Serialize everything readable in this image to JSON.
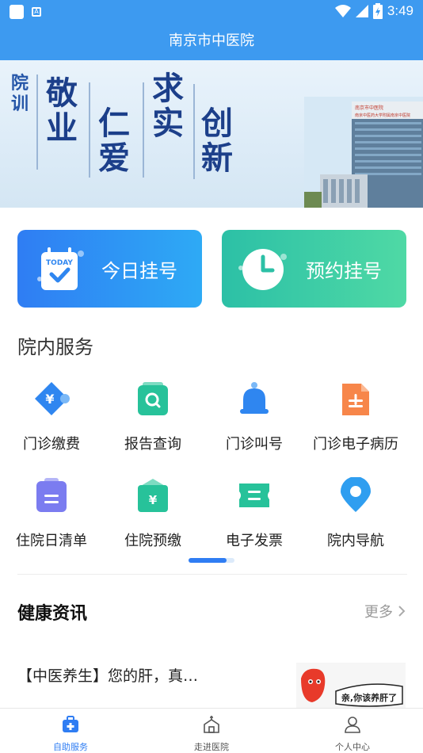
{
  "status_bar": {
    "time": "3:49"
  },
  "title": "南京市中医院",
  "banner": {
    "label": "院训",
    "motto": [
      "敬业",
      "仁爱",
      "求实",
      "创新"
    ],
    "building_sign_1": "南京市中医院",
    "building_sign_2": "南京中医药大学附属南京中医院"
  },
  "quick_actions": [
    {
      "label": "今日挂号",
      "icon_badge": "TODAY"
    },
    {
      "label": "预约挂号"
    }
  ],
  "services": {
    "title": "院内服务",
    "items": [
      {
        "label": "门诊缴费",
        "icon": "yuan-payment-icon",
        "color": "#2f86f0"
      },
      {
        "label": "报告查询",
        "icon": "report-search-icon",
        "color": "#27c29a"
      },
      {
        "label": "门诊叫号",
        "icon": "bell-icon",
        "color": "#2f86f0"
      },
      {
        "label": "门诊电子病历",
        "icon": "document-icon",
        "color": "#f7864a"
      },
      {
        "label": "住院日清单",
        "icon": "clipboard-icon",
        "color": "#7b7cf0"
      },
      {
        "label": "住院预缴",
        "icon": "yuan-envelope-icon",
        "color": "#27c29a"
      },
      {
        "label": "电子发票",
        "icon": "ticket-icon",
        "color": "#27c29a"
      },
      {
        "label": "院内导航",
        "icon": "location-pin-icon",
        "color": "#2f9ef0"
      }
    ]
  },
  "news": {
    "title": "健康资讯",
    "more_label": "更多",
    "items": [
      {
        "title": "【中医养生】您的肝，真…",
        "thumb_text": "亲,你该养肝了"
      }
    ]
  },
  "tabs": [
    {
      "label": "自助服务",
      "icon": "medical-bag-icon",
      "active": true
    },
    {
      "label": "走进医院",
      "icon": "hospital-icon",
      "active": false
    },
    {
      "label": "个人中心",
      "icon": "user-icon",
      "active": false
    }
  ],
  "colors": {
    "primary": "#3d9af0",
    "accent_blue": "#2f7df3",
    "accent_green": "#2cc0a6"
  }
}
